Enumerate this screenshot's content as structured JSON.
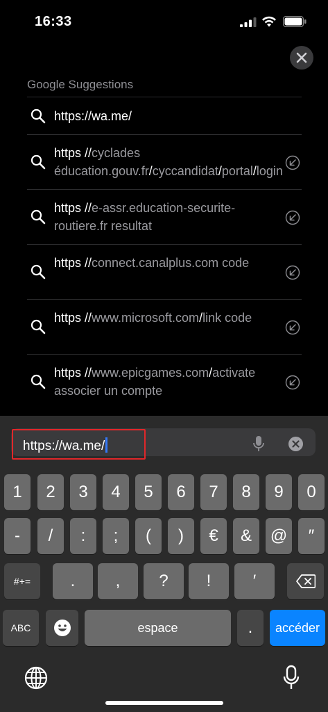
{
  "status": {
    "time": "16:33"
  },
  "suggestions": {
    "header": "Google Suggestions",
    "first": "https://wa.me/",
    "items": [
      {
        "parts": [
          {
            "t": "https //",
            "c": "hl"
          },
          {
            "t": "cyclades éducation.gouv.fr",
            "c": "dim"
          },
          {
            "t": "/",
            "c": "hl"
          },
          {
            "t": "cyccandidat",
            "c": "dim"
          },
          {
            "t": "/",
            "c": "hl"
          },
          {
            "t": "portal",
            "c": "dim"
          },
          {
            "t": "/",
            "c": "hl"
          },
          {
            "t": "login",
            "c": "dim"
          }
        ]
      },
      {
        "parts": [
          {
            "t": "https //",
            "c": "hl"
          },
          {
            "t": "e-assr.education-securite-routiere.fr resultat",
            "c": "dim"
          }
        ]
      },
      {
        "parts": [
          {
            "t": "https //",
            "c": "hl"
          },
          {
            "t": "connect.canalplus.com code",
            "c": "dim"
          }
        ]
      },
      {
        "parts": [
          {
            "t": "https //",
            "c": "hl"
          },
          {
            "t": "www.microsoft.com",
            "c": "dim"
          },
          {
            "t": "/",
            "c": "hl"
          },
          {
            "t": "link code",
            "c": "dim"
          }
        ]
      },
      {
        "parts": [
          {
            "t": "https //",
            "c": "hl"
          },
          {
            "t": "www.epicgames.com",
            "c": "dim"
          },
          {
            "t": "/",
            "c": "hl"
          },
          {
            "t": "activate associer un compte",
            "c": "dim"
          }
        ]
      }
    ]
  },
  "url_bar": {
    "value": "https://wa.me/"
  },
  "keyboard": {
    "row1": [
      "1",
      "2",
      "3",
      "4",
      "5",
      "6",
      "7",
      "8",
      "9",
      "0"
    ],
    "row2": [
      "-",
      "/",
      ":",
      ";",
      "(",
      ")",
      "€",
      "&",
      "@",
      "″"
    ],
    "row3_left": "#+=",
    "row3": [
      ".",
      ",",
      "?",
      "!",
      "′"
    ],
    "abc": "ABC",
    "space": "espace",
    "period": ".",
    "go": "accéder"
  },
  "colors": {
    "accent": "#0a84ff",
    "highlight_box": "#e0272a"
  }
}
